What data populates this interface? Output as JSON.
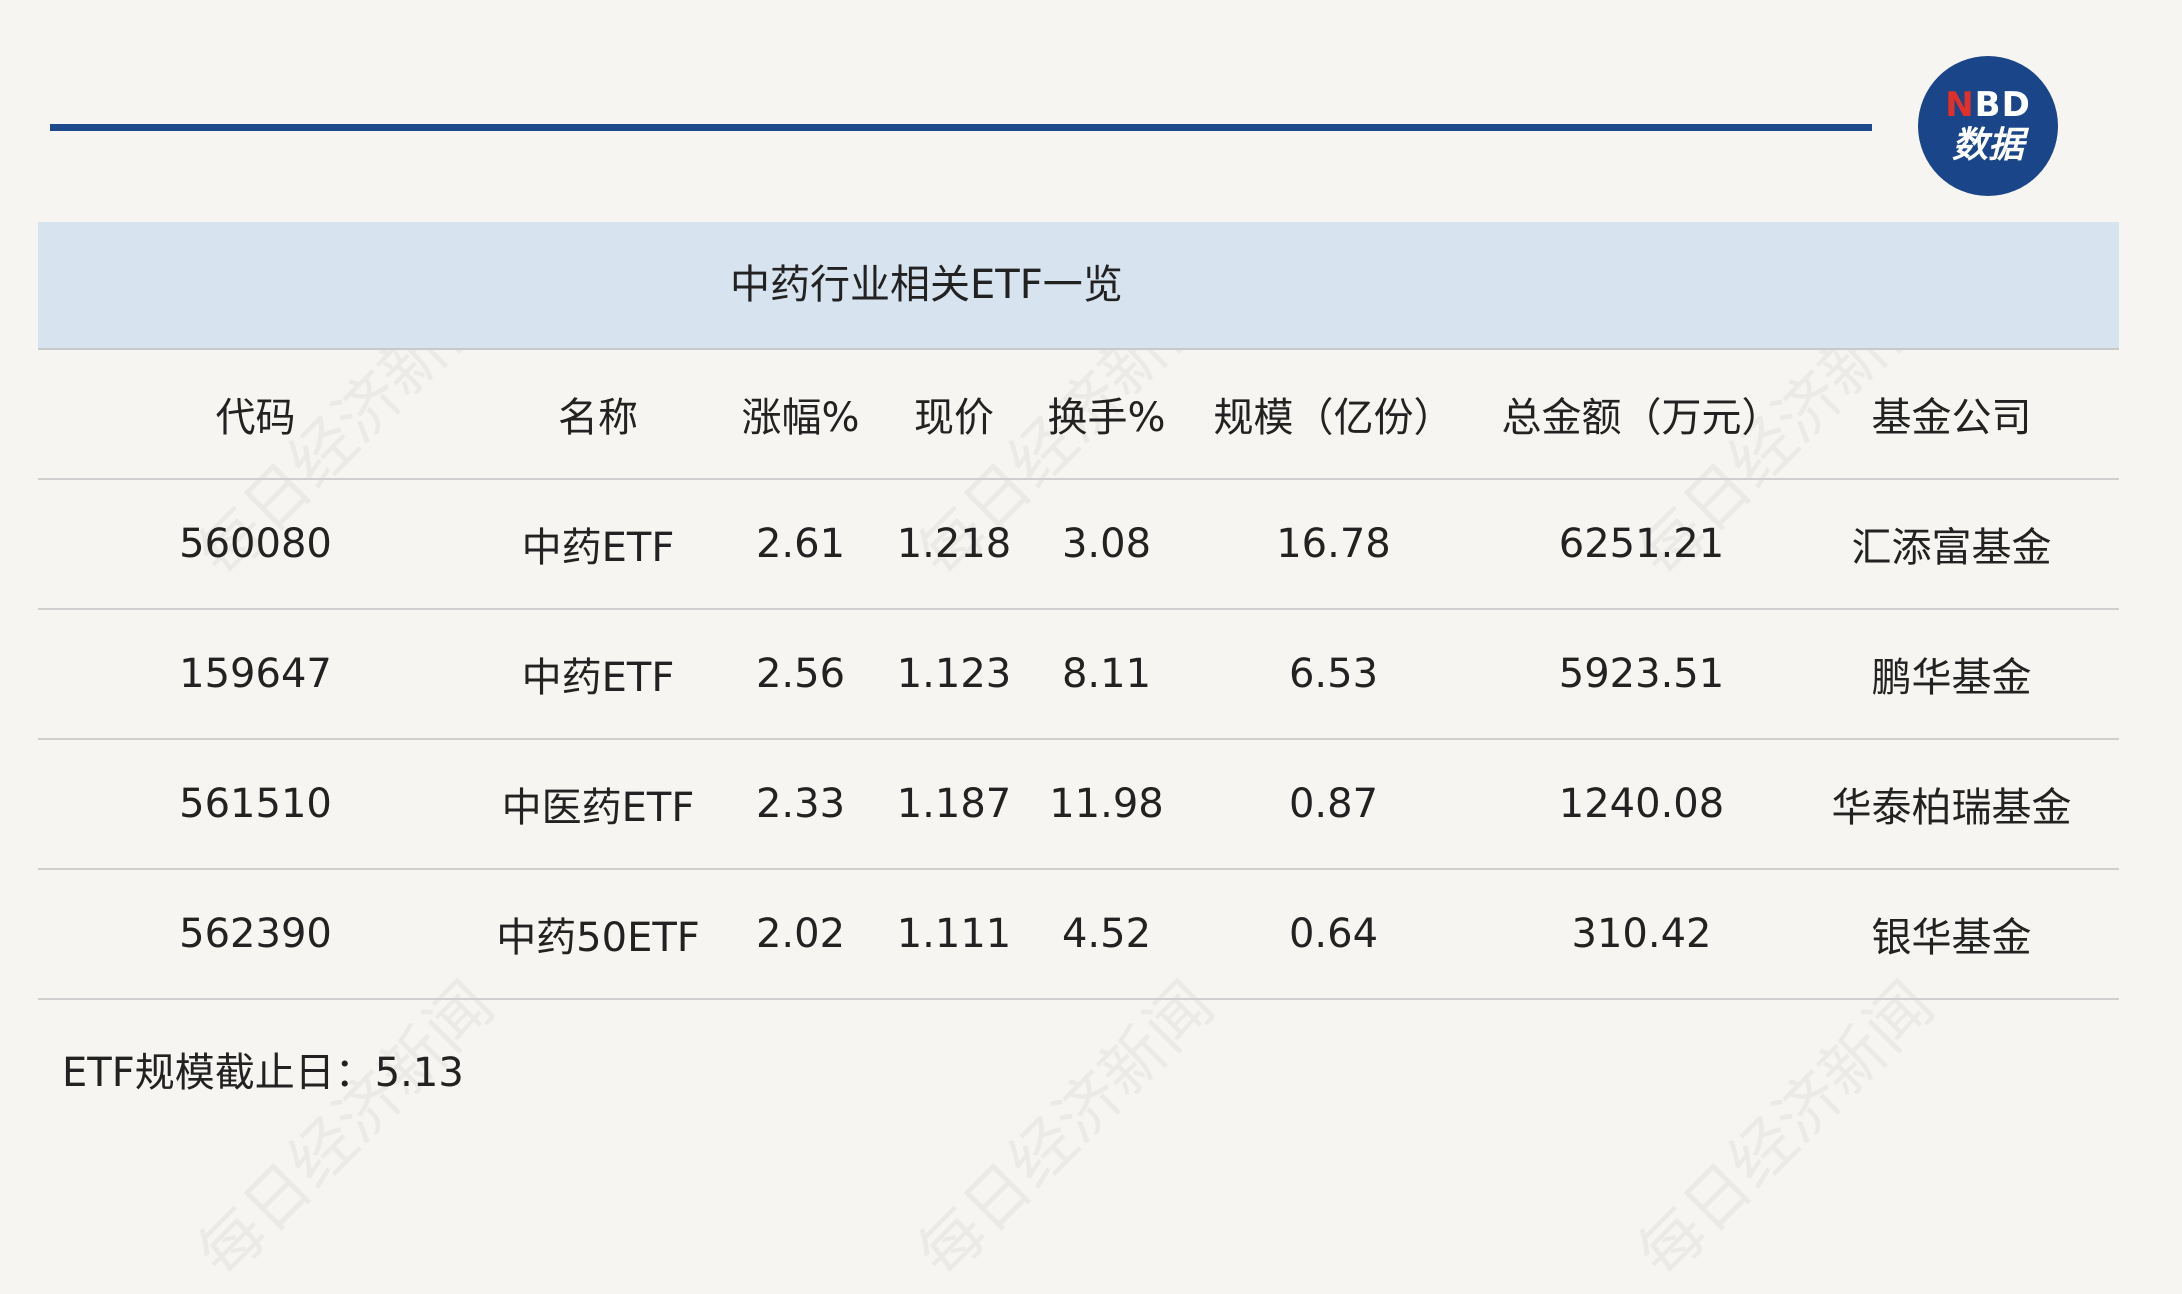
{
  "logo": {
    "top_n": "N",
    "top_rest": "BD",
    "bottom": "数据"
  },
  "table": {
    "title": "中药行业相关ETF一览",
    "headers": [
      "代码",
      "名称",
      "涨幅%",
      "现价",
      "换手%",
      "规模（亿份）",
      "总金额（万元）",
      "基金公司"
    ],
    "rows": [
      [
        "560080",
        "中药ETF",
        "2.61",
        "1.218",
        "3.08",
        "16.78",
        "6251.21",
        "汇添富基金"
      ],
      [
        "159647",
        "中药ETF",
        "2.56",
        "1.123",
        "8.11",
        "6.53",
        "5923.51",
        "鹏华基金"
      ],
      [
        "561510",
        "中医药ETF",
        "2.33",
        "1.187",
        "11.98",
        "0.87",
        "1240.08",
        "华泰柏瑞基金"
      ],
      [
        "562390",
        "中药50ETF",
        "2.02",
        "1.111",
        "4.52",
        "0.64",
        "310.42",
        "银华基金"
      ]
    ]
  },
  "footnote": "ETF规模截止日：5.13",
  "watermark": "每日经济新闻"
}
